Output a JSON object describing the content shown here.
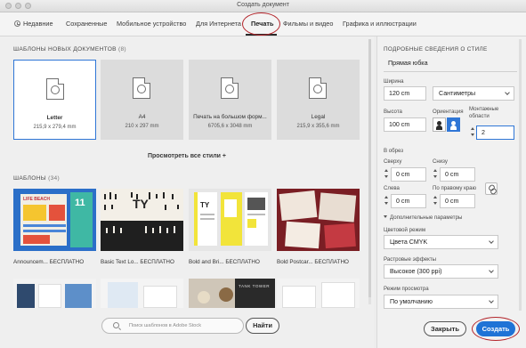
{
  "window": {
    "title": "Создать документ"
  },
  "tabs": [
    {
      "label": "Недавние"
    },
    {
      "label": "Сохраненные"
    },
    {
      "label": "Мобильное устройство"
    },
    {
      "label": "Для Интернета"
    },
    {
      "label": "Печать",
      "active": true
    },
    {
      "label": "Фильмы и видео"
    },
    {
      "label": "Графика и иллюстрации"
    }
  ],
  "presets": {
    "heading": "ШАБЛОНЫ НОВЫХ ДОКУМЕНТОВ",
    "count": "(8)",
    "items": [
      {
        "name": "Letter",
        "size": "215,9 x 279,4 mm",
        "selected": true
      },
      {
        "name": "A4",
        "size": "210 x 297 mm"
      },
      {
        "name": "Печать на большом форм...",
        "size": "6705,6 x 3048 mm"
      },
      {
        "name": "Legal",
        "size": "215,9 x 355,6 mm"
      }
    ],
    "view_all": "Просмотреть все стили +"
  },
  "templates": {
    "heading": "ШАБЛОНЫ",
    "count": "(34)",
    "items": [
      {
        "name": "Announcem...",
        "badge": "БЕСПЛАТНО"
      },
      {
        "name": "Basic Text Lo...",
        "badge": "БЕСПЛАТНО"
      },
      {
        "name": "Bold and Bri...",
        "badge": "БЕСПЛАТНО"
      },
      {
        "name": "Bold Postcar...",
        "badge": "БЕСПЛАТНО"
      }
    ],
    "thumb_text": {
      "t1_a": "LIFE BEACH",
      "t1_b": "11",
      "t2_a": "TY",
      "t3_a": "TY",
      "t6_a": "TANK TOWER"
    }
  },
  "search": {
    "placeholder": "Поиск шаблонов в Adobe Stock",
    "button": "Найти"
  },
  "details": {
    "heading": "ПОДРОБНЫЕ СВЕДЕНИЯ О СТИЛЕ",
    "name_value": "Прямая юбка",
    "width_label": "Ширина",
    "width_value": "120 cm",
    "units_value": "Сантиметры",
    "height_label": "Высота",
    "height_value": "100 cm",
    "orientation_label": "Ориентация",
    "artboards_label": "Монтажные области",
    "artboards_value": "2",
    "bleed_label": "В обрез",
    "top_label": "Сверху",
    "top_value": "0 cm",
    "bottom_label": "Снизу",
    "bottom_value": "0 cm",
    "left_label": "Слева",
    "left_value": "0 cm",
    "right_label": "По правому краю",
    "right_value": "0 cm",
    "advanced_label": "Дополнительные параметры",
    "color_mode_label": "Цветовой режим",
    "color_mode_value": "Цвета CMYK",
    "raster_label": "Растровые эффекты",
    "raster_value": "Высокое (300 ppi)",
    "preview_label": "Режим просмотра",
    "preview_value": "По умолчанию"
  },
  "actions": {
    "close": "Закрыть",
    "create": "Создать"
  },
  "colors": {
    "accent": "#1f73d6",
    "selection": "#2f76d6",
    "annotation": "#b3242a"
  }
}
